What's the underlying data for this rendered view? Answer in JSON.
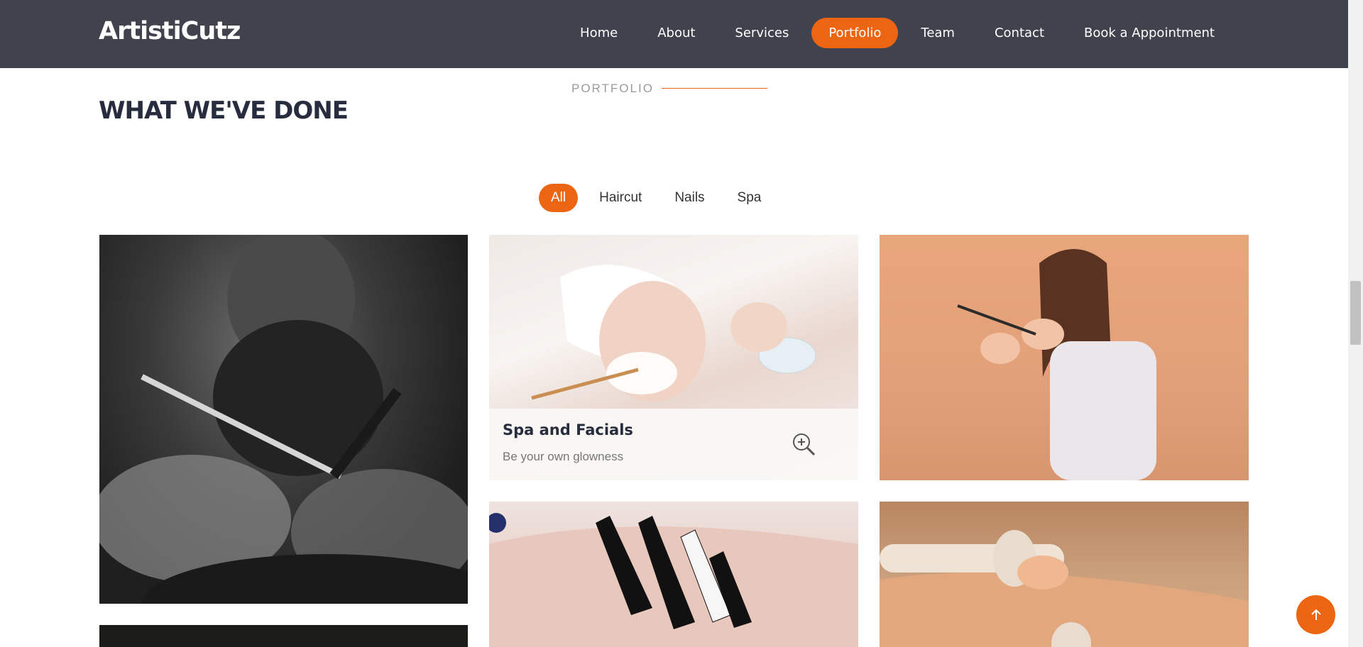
{
  "header": {
    "logo": "ArtistiCutz",
    "nav": [
      {
        "label": "Home",
        "active": false
      },
      {
        "label": "About",
        "active": false
      },
      {
        "label": "Services",
        "active": false
      },
      {
        "label": "Portfolio",
        "active": true
      },
      {
        "label": "Team",
        "active": false
      },
      {
        "label": "Contact",
        "active": false
      },
      {
        "label": "Book a Appointment",
        "active": false
      }
    ]
  },
  "section": {
    "kicker": "PORTFOLIO",
    "title": "WHAT WE'VE DONE"
  },
  "filters": [
    {
      "label": "All",
      "active": true
    },
    {
      "label": "Haircut",
      "active": false
    },
    {
      "label": "Nails",
      "active": false
    },
    {
      "label": "Spa",
      "active": false
    }
  ],
  "portfolio": {
    "items": [
      {
        "icon": "barber-photo"
      },
      {
        "icon": "spa-facial-photo",
        "title": "Spa and Facials",
        "subtitle": "Be your own glowness"
      },
      {
        "icon": "haircut-photo"
      },
      {
        "icon": "nail-art-photo"
      },
      {
        "icon": "massage-photo"
      },
      {
        "icon": "salon-photo"
      }
    ]
  },
  "colors": {
    "accent": "#ec6513",
    "header_bg": "#40434d",
    "title": "#272d3f"
  }
}
